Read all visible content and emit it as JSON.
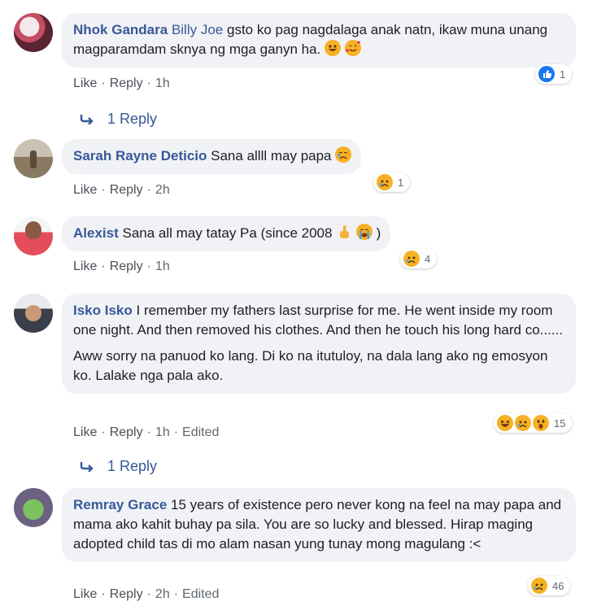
{
  "comments": [
    {
      "name": "Nhok Gandara",
      "tag": "Billy Joe",
      "text": "gsto ko pag nagdalaga anak natn, ikaw muna unang magparamdam sknya ng mga ganyn ha.",
      "emoji_icons": [
        "grinning-face-icon",
        "smiling-face-with-hearts-icon"
      ],
      "actions": {
        "like": "Like",
        "reply": "Reply",
        "time": "1h"
      },
      "reactions": {
        "icons": [
          "like-icon"
        ],
        "count": "1"
      },
      "replies_link": "1 Reply"
    },
    {
      "name": "Sarah Rayne Deticio",
      "text": "Sana allll may papa",
      "emoji_icons": [
        "crying-face-icon"
      ],
      "actions": {
        "like": "Like",
        "reply": "Reply",
        "time": "2h"
      },
      "reactions": {
        "icons": [
          "sad-icon"
        ],
        "count": "1"
      }
    },
    {
      "name": "Alexist",
      "text": "Sana all may tatay Pa (since 2008",
      "text_end": ")",
      "emoji_icons": [
        "pointing-finger-icon",
        "loudly-crying-face-icon"
      ],
      "actions": {
        "like": "Like",
        "reply": "Reply",
        "time": "1h"
      },
      "reactions": {
        "icons": [
          "sad-icon"
        ],
        "count": "4"
      }
    },
    {
      "name": "Isko Isko",
      "text": "I remember my fathers last surprise for me. He went inside my room one night. And then removed his clothes. And then he touch his long hard co......",
      "text2": "Aww sorry na panuod ko lang. Di ko na itutuloy, na dala lang ako ng emosyon ko. Lalake nga pala ako.",
      "actions": {
        "like": "Like",
        "reply": "Reply",
        "time": "1h",
        "edited": "Edited"
      },
      "reactions": {
        "icons": [
          "haha-icon",
          "sad-icon",
          "wow-icon"
        ],
        "count": "15"
      },
      "replies_link": "1 Reply"
    },
    {
      "name": "Remray Grace",
      "text": "15 years of existence pero never kong na feel na may papa and mama ako kahit buhay pa sila. You are so lucky and blessed. Hirap maging adopted child tas di mo alam nasan yung tunay mong magulang :<",
      "actions": {
        "like": "Like",
        "reply": "Reply",
        "time": "2h",
        "edited": "Edited"
      },
      "reactions": {
        "icons": [
          "sad-icon"
        ],
        "count": "46"
      }
    }
  ],
  "colors": {
    "name": "#385898",
    "bubble": "#f0f2f5",
    "meta": "#606770",
    "like_blue": "#1877f2",
    "emoji_yellow": "#f7b125"
  }
}
